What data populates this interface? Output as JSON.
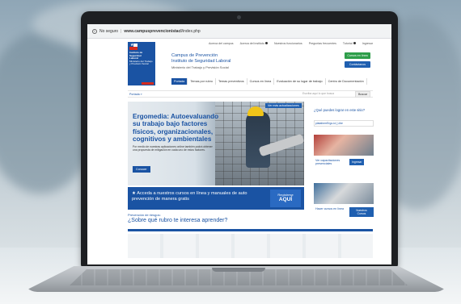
{
  "browser": {
    "security_label": "No seguro",
    "url_host": "www.campusprevencionistacl",
    "url_path": "/index.php"
  },
  "site": {
    "top_links": [
      "Acerca del campus",
      "Acerca del instituto",
      "Nuestros funcionarios",
      "Preguntas frecuentes",
      "Tutorial",
      "Ingresar"
    ],
    "logo_lines": [
      "Instituto de",
      "Seguridad",
      "Laboral",
      "Ministerio del Trabajo",
      "y Previsión Social",
      "Gobierno de Chile"
    ],
    "org_name_line1": "Campus de Prevención",
    "org_name_line2": "Instituto de Seguridad Laboral",
    "org_ministry": "Ministerio del Trabajo y Previsión Social",
    "btn_green": "Cursos en línea",
    "btn_blue": "Contáctanos",
    "nav": [
      "Portada",
      "Temas por rubro",
      "Temas preventivos",
      "Cursos en línea",
      "Evaluación de su lugar de trabajo",
      "Centro de Documentación"
    ],
    "crumb": "Portada »",
    "search_placeholder": "Escriba aquí lo que busca",
    "search_button": "Buscar"
  },
  "hero": {
    "tag": "Ver más actualizaciones",
    "title": "Ergomedia: Autoevaluando su trabajo bajo factores físicos, organizacionales, cognitivos y ambientales",
    "desc": "Por medio de nuestras aplicaciones online también podrá obtener una propuesta de mitigación en cada uno de estos factores.",
    "button": "Conocer"
  },
  "banner": {
    "text": "★ Acceda a nuestros cursos en línea y manuales de auto prevención de manera gratis",
    "btn_top": "Regístrese",
    "btn_main": "AQUÍ"
  },
  "prevention": {
    "label": "Prevención de riesgos:",
    "question": "¿Sobre qué rubro te interesa aprender?"
  },
  "right": {
    "question": "¿Qué puedes lograr en este sitio?",
    "image_label": "plataformErgo-icl_Libe",
    "card1_text": "Ver capacitaciones presenciales",
    "card1_btn": "Ingresar",
    "card2_text": "Hacer cursos en línea",
    "card2_btn": "Nuestros Cursos"
  },
  "colors": {
    "brand_blue": "#1a53a3",
    "green": "#2e9e4a",
    "red": "#d52b1e"
  }
}
